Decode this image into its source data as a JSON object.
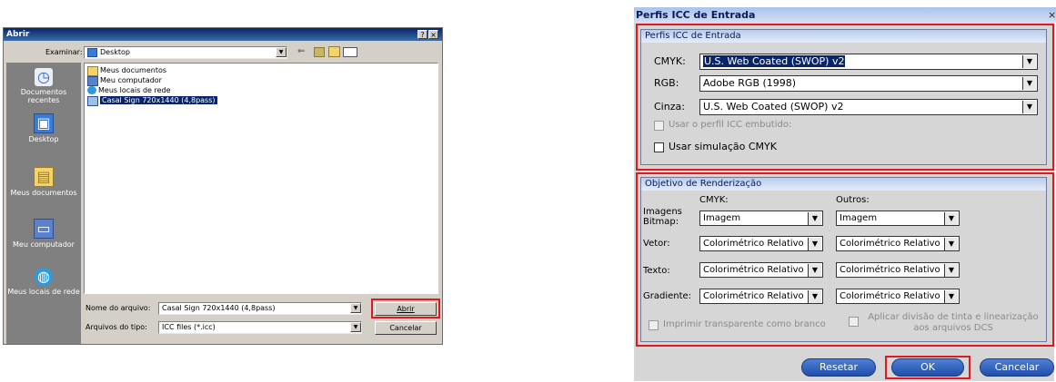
{
  "open_dialog": {
    "title": "Abrir",
    "title_buttons": [
      "?",
      "×"
    ],
    "look_in_label": "Examinar:",
    "look_in_value": "Desktop",
    "places": [
      {
        "label": "Documentos recentes",
        "icon": "recent-documents-icon"
      },
      {
        "label": "Desktop",
        "icon": "desktop-icon"
      },
      {
        "label": "Meus documentos",
        "icon": "my-documents-icon"
      },
      {
        "label": "Meu computador",
        "icon": "my-computer-icon"
      },
      {
        "label": "Meus locais de rede",
        "icon": "network-places-icon"
      }
    ],
    "files": [
      {
        "name": "Meus documentos",
        "icon": "folder-icon",
        "selected": false
      },
      {
        "name": "Meu computador",
        "icon": "computer-icon",
        "selected": false
      },
      {
        "name": "Meus locais de rede",
        "icon": "network-icon",
        "selected": false
      },
      {
        "name": "Casal Sign 720x1440 (4,8pass)",
        "icon": "icc-file-icon",
        "selected": true
      }
    ],
    "filename_label": "Nome do arquivo:",
    "filename_value": "Casal Sign 720x1440 (4,8pass)",
    "filetype_label": "Arquivos do tipo:",
    "filetype_value": "ICC files (*.icc)",
    "open_button": "Abrir",
    "cancel_button": "Cancelar"
  },
  "icc_dialog": {
    "title": "Perfis ICC de Entrada",
    "close_glyph": "×",
    "profiles_group": {
      "heading": "Perfis ICC de Entrada",
      "cmyk_label": "CMYK:",
      "cmyk_value": "U.S. Web Coated (SWOP) v2",
      "rgb_label": "RGB:",
      "rgb_value": "Adobe RGB (1998)",
      "gray_label": "Cinza:",
      "gray_value": "U.S. Web Coated (SWOP) v2",
      "embedded_checkbox": "Usar o perfil ICC embutido:",
      "simulation_checkbox": "Usar simulação CMYK"
    },
    "rendering_group": {
      "heading": "Objetivo de Renderização",
      "col_cmyk": "CMYK:",
      "col_other": "Outros:",
      "rows": [
        {
          "label": "Imagens Bitmap:",
          "cmyk": "Imagem",
          "other": "Imagem"
        },
        {
          "label": "Vetor:",
          "cmyk": "Colorimétrico Relativo",
          "other": "Colorimétrico Relativo"
        },
        {
          "label": "Texto:",
          "cmyk": "Colorimétrico Relativo",
          "other": "Colorimétrico Relativo"
        },
        {
          "label": "Gradiente:",
          "cmyk": "Colorimétrico Relativo",
          "other": "Colorimétrico Relativo"
        }
      ],
      "print_transparent_checkbox": "Imprimir transparente como branco",
      "ink_split_checkbox": "Aplicar divisão de tinta e linearização aos arquivos DCS"
    },
    "reset_button": "Resetar",
    "ok_button": "OK",
    "cancel_button": "Cancelar"
  },
  "colors": {
    "highlight": "#e0181f",
    "selection": "#0a246a",
    "pill_blue": "#2a5bb8"
  }
}
